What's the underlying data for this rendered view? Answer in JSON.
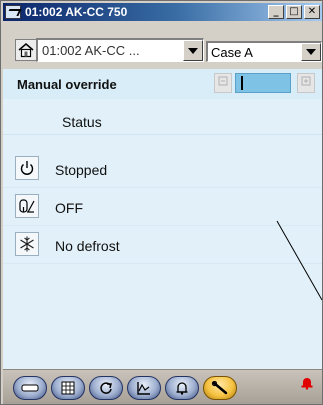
{
  "window": {
    "title": "01:002 AK-CC 750",
    "minimize": "_",
    "maximize": "□",
    "close": "✕"
  },
  "device": {
    "home_icon": "home-icon",
    "selected": "01:002 AK-CC ...",
    "case_selected": "Case A"
  },
  "override": {
    "label": "Manual override",
    "minus_icon": "minus-icon",
    "plus_icon": "plus-icon",
    "value": ""
  },
  "status": {
    "header": "Status",
    "rows": [
      {
        "icon": "power-icon",
        "text": "Stopped"
      },
      {
        "icon": "valve-icon",
        "text": "OFF"
      },
      {
        "icon": "snowflake-icon",
        "text": "No defrost"
      }
    ]
  },
  "toolbar": {
    "items": [
      "overview-icon",
      "table-icon",
      "refresh-icon",
      "graph-icon",
      "alarm-bell-icon",
      "wrench-icon"
    ],
    "active": "wrench-icon",
    "alarm_color": "#e00000"
  },
  "colors": {
    "titlebar_start": "#0a246a",
    "content_bg": "#e2f1f9",
    "override_field": "#7ec3e6"
  }
}
